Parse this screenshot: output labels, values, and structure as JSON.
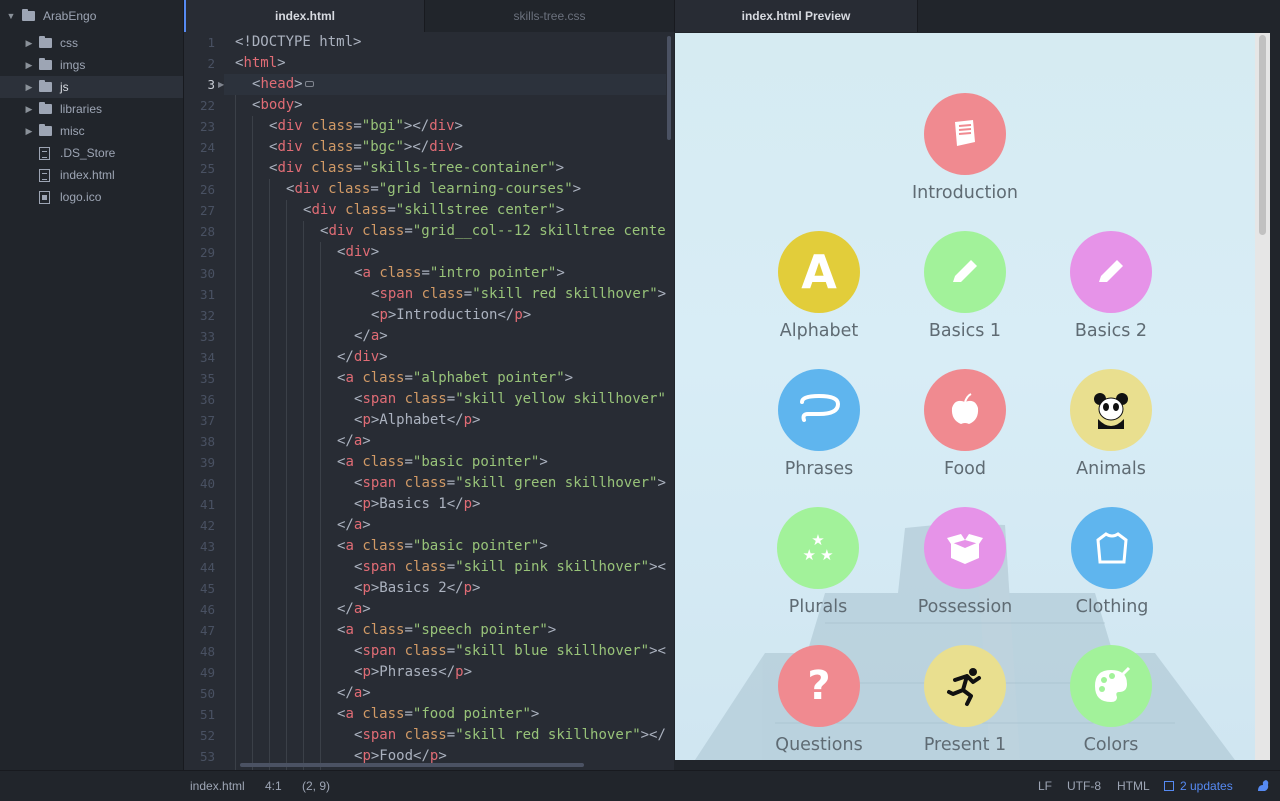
{
  "sidebar": {
    "project": "ArabEngo",
    "items": [
      {
        "label": "css",
        "type": "folder"
      },
      {
        "label": "imgs",
        "type": "folder"
      },
      {
        "label": "js",
        "type": "folder"
      },
      {
        "label": "libraries",
        "type": "folder"
      },
      {
        "label": "misc",
        "type": "folder"
      },
      {
        "label": ".DS_Store",
        "type": "file"
      },
      {
        "label": "index.html",
        "type": "file"
      },
      {
        "label": "logo.ico",
        "type": "media"
      }
    ]
  },
  "tabs": [
    {
      "label": "index.html",
      "active": true
    },
    {
      "label": "skills-tree.css",
      "active": false
    },
    {
      "label": "index.html Preview",
      "active": true
    }
  ],
  "editor": {
    "line_numbers": [
      "1",
      "2",
      "3",
      "22",
      "23",
      "24",
      "25",
      "26",
      "27",
      "28",
      "29",
      "30",
      "31",
      "32",
      "33",
      "34",
      "35",
      "36",
      "37",
      "38",
      "39",
      "40",
      "41",
      "42",
      "43",
      "44",
      "45",
      "46",
      "47",
      "48",
      "49",
      "50",
      "51",
      "52",
      "53"
    ],
    "current_line": "3"
  },
  "preview": {
    "skills": [
      {
        "label": "Introduction",
        "color": "#f08a90",
        "icon": "book-icon"
      },
      {
        "label": "Alphabet",
        "color": "#e2cd3a",
        "icon": "letter-a-icon"
      },
      {
        "label": "Basics 1",
        "color": "#a2f29a",
        "icon": "pencil-icon"
      },
      {
        "label": "Basics 2",
        "color": "#e693e8",
        "icon": "pencil-icon"
      },
      {
        "label": "Phrases",
        "color": "#5fb5ee",
        "icon": "speech-bubble-icon"
      },
      {
        "label": "Food",
        "color": "#f08a90",
        "icon": "apple-icon"
      },
      {
        "label": "Animals",
        "color": "#e9df8f",
        "icon": "panda-icon"
      },
      {
        "label": "Plurals",
        "color": "#a2f29a",
        "icon": "stars-icon"
      },
      {
        "label": "Possession",
        "color": "#e693e8",
        "icon": "box-icon"
      },
      {
        "label": "Clothing",
        "color": "#5fb5ee",
        "icon": "shirt-icon"
      },
      {
        "label": "Questions",
        "color": "#f08a90",
        "icon": "question-icon"
      },
      {
        "label": "Present 1",
        "color": "#e9df8f",
        "icon": "runner-icon"
      },
      {
        "label": "Colors",
        "color": "#a2f29a",
        "icon": "palette-icon"
      }
    ]
  },
  "status": {
    "file": "index.html",
    "cursor": "4:1",
    "selection": "(2, 9)",
    "line_ending": "LF",
    "encoding": "UTF-8",
    "grammar": "HTML",
    "updates": "2 updates"
  },
  "colors": {
    "accent": "#568af2",
    "tag": "#e06c75",
    "attribute": "#d19a66",
    "string": "#98c379"
  }
}
